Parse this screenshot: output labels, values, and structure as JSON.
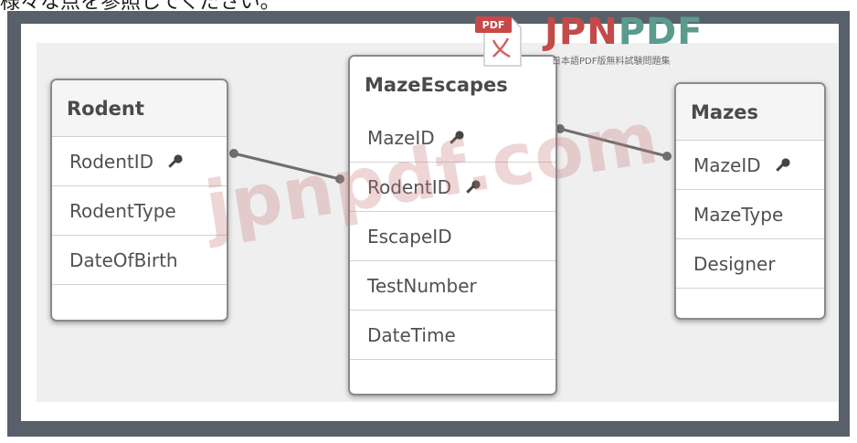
{
  "caption": "様々な点を参照してください。",
  "tables": [
    {
      "id": "rodent",
      "title": "Rodent",
      "fields": [
        {
          "label": "RodentID",
          "key": true
        },
        {
          "label": "RodentType",
          "key": false
        },
        {
          "label": "DateOfBirth",
          "key": false
        },
        {
          "label": "",
          "key": false
        }
      ]
    },
    {
      "id": "maze-escapes",
      "title": "MazeEscapes",
      "fields": [
        {
          "label": "MazeID",
          "key": true
        },
        {
          "label": "RodentID",
          "key": true
        },
        {
          "label": "EscapeID",
          "key": false
        },
        {
          "label": "TestNumber",
          "key": false
        },
        {
          "label": "DateTime",
          "key": false
        },
        {
          "label": "",
          "key": false
        }
      ]
    },
    {
      "id": "mazes",
      "title": "Mazes",
      "fields": [
        {
          "label": "MazeID",
          "key": true
        },
        {
          "label": "MazeType",
          "key": false
        },
        {
          "label": "Designer",
          "key": false
        },
        {
          "label": "",
          "key": false
        }
      ]
    }
  ],
  "relationships": [
    {
      "from": "Rodent.RodentID",
      "to": "MazeEscapes.RodentID"
    },
    {
      "from": "MazeEscapes.MazeID",
      "to": "Mazes.MazeID"
    }
  ],
  "watermark": {
    "logo_badge": "PDF",
    "logo_jpn": "JPN",
    "logo_pdf": "PDF",
    "logo_subtitle": "日本語PDF版無料試験問題集",
    "overlay_text": "jpnpdf.com"
  },
  "colors": {
    "frame": "#58616a",
    "canvas": "#efefef",
    "connector": "#6e6e6e",
    "logo_red": "#c44a4a",
    "logo_green": "#5b9b8e"
  },
  "icons": {
    "primary_key": "key-icon"
  }
}
